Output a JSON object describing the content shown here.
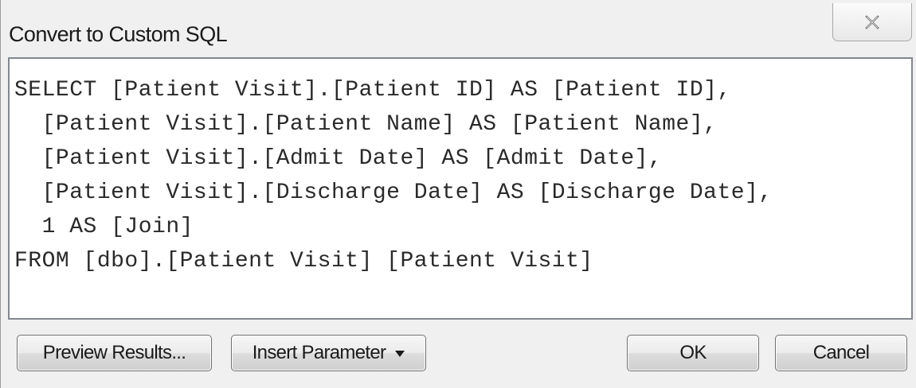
{
  "window": {
    "title": "Convert to Custom SQL"
  },
  "icons": {
    "close": "close-icon",
    "dropdown": "caret-down-icon"
  },
  "editor": {
    "lines": [
      "SELECT [Patient Visit].[Patient ID] AS [Patient ID],",
      "  [Patient Visit].[Patient Name] AS [Patient Name],",
      "  [Patient Visit].[Admit Date] AS [Admit Date],",
      "  [Patient Visit].[Discharge Date] AS [Discharge Date],",
      "  1 AS [Join]",
      "FROM [dbo].[Patient Visit] [Patient Visit]"
    ]
  },
  "buttons": {
    "preview_label": "Preview Results...",
    "insert_parameter_label": "Insert Parameter",
    "ok_label": "OK",
    "cancel_label": "Cancel"
  }
}
